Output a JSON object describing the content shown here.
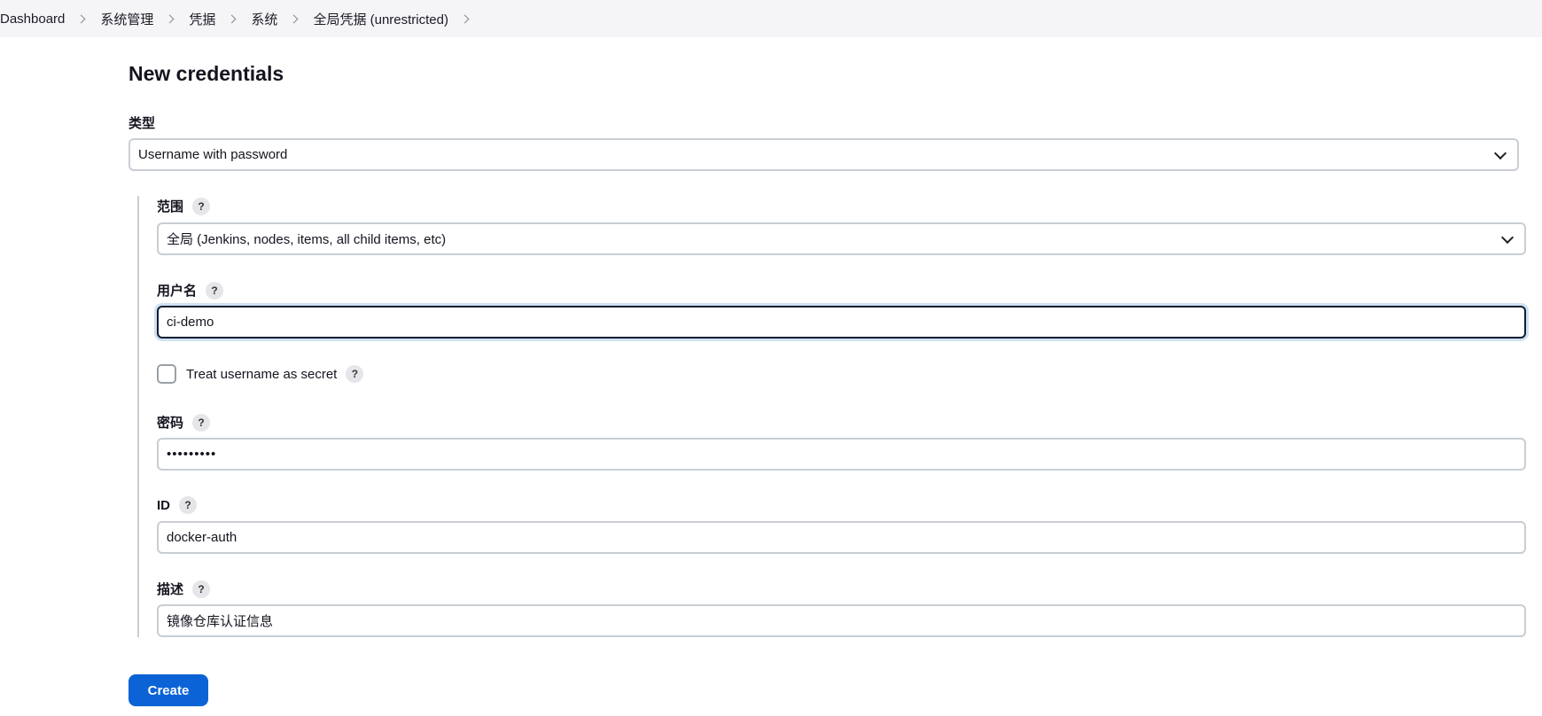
{
  "breadcrumb": [
    {
      "label": "Dashboard"
    },
    {
      "label": "系统管理"
    },
    {
      "label": "凭据"
    },
    {
      "label": "系统"
    },
    {
      "label": "全局凭据 (unrestricted)"
    }
  ],
  "page": {
    "title": "New credentials"
  },
  "form": {
    "type_label": "类型",
    "type_value": "Username with password",
    "scope_label": "范围",
    "scope_value": "全局 (Jenkins, nodes, items, all child items, etc)",
    "username_label": "用户名",
    "username_value": "ci-demo",
    "treat_secret_label": "Treat username as secret",
    "treat_secret_checked": false,
    "password_label": "密码",
    "password_value": "•••••••••",
    "id_label": "ID",
    "id_value": "docker-auth",
    "description_label": "描述",
    "description_value": "镜像仓库认证信息",
    "help_glyph": "?",
    "create_label": "Create"
  },
  "icons": {
    "breadcrumb_separator": "chevron-right-icon",
    "select_arrow": "chevron-down-icon",
    "help": "help-icon"
  },
  "colors": {
    "primary_button": "#0b63d6",
    "focus_border": "#0f1e33",
    "breadcrumb_bg": "#f5f5f7"
  }
}
